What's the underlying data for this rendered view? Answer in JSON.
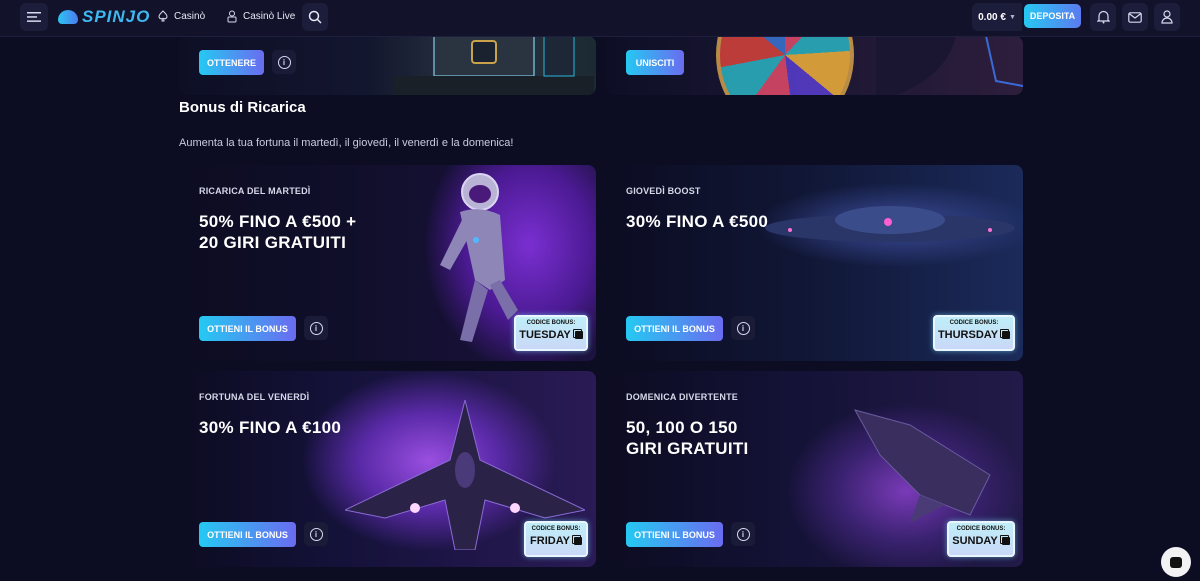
{
  "header": {
    "brand": "SPINJO",
    "nav": [
      {
        "label": "Casinò",
        "icon": "spade-icon"
      },
      {
        "label": "Casinò Live",
        "icon": "dealer-icon"
      }
    ],
    "balance": "0.00 €",
    "deposit_label": "DEPOSITA"
  },
  "top_cards": [
    {
      "button": "OTTENERE"
    },
    {
      "button": "UNISCITI"
    }
  ],
  "section": {
    "title": "Bonus di Ricarica",
    "description": "Aumenta la tua fortuna il martedì, il giovedì, il venerdì e la domenica!"
  },
  "bonuses": [
    {
      "label": "RICARICA DEL MARTEDÌ",
      "line1": "50% FINO A €500 +",
      "line2": "20 GIRI GRATUITI",
      "button": "OTTIENI IL BONUS",
      "code_caption": "CODICE BONUS:",
      "code": "TUESDAY"
    },
    {
      "label": "GIOVEDÌ BOOST",
      "line1": "30% FINO A €500",
      "line2": "",
      "button": "OTTIENI IL BONUS",
      "code_caption": "CODICE BONUS:",
      "code": "THURSDAY"
    },
    {
      "label": "FORTUNA DEL VENERDÌ",
      "line1": "30% FINO A €100",
      "line2": "",
      "button": "OTTIENI IL BONUS",
      "code_caption": "CODICE BONUS:",
      "code": "FRIDAY"
    },
    {
      "label": "DOMENICA DIVERTENTE",
      "line1": "50, 100 O 150",
      "line2": "GIRI GRATUITI",
      "button": "OTTIENI IL BONUS",
      "code_caption": "CODICE BONUS:",
      "code": "SUNDAY"
    }
  ],
  "colors": {
    "accent_start": "#25c9f2",
    "accent_end": "#6a6cf0",
    "background": "#0c0c22"
  }
}
